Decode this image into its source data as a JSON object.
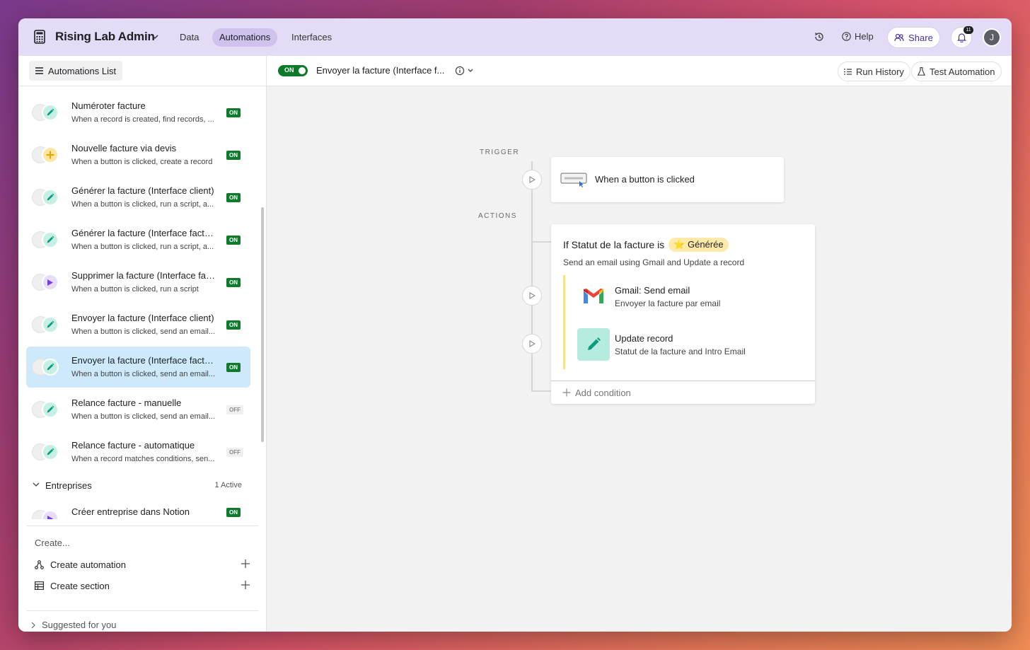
{
  "app": {
    "title": "Rising Lab Admin",
    "nav": [
      "Data",
      "Automations",
      "Interfaces"
    ],
    "active_nav": "Automations",
    "help_label": "Help",
    "share_label": "Share",
    "notification_count": "11",
    "avatar_initial": "J",
    "accent": "#e4dcf6"
  },
  "sidebar": {
    "list_button": "Automations List",
    "automations": [
      {
        "title": "Numéroter facture",
        "subtitle": "When a record is created, find records, ...",
        "status": "ON",
        "trigger_icon": "record-icon",
        "action_icon": "pencil-icon",
        "action_color": "#c7f0e4"
      },
      {
        "title": "Nouvelle facture via devis",
        "subtitle": "When a button is clicked, create a record",
        "status": "ON",
        "trigger_icon": "button-icon",
        "action_icon": "plus-icon",
        "action_color": "#fde6a4"
      },
      {
        "title": "Générer la facture (Interface client)",
        "subtitle": "When a button is clicked, run a script, a...",
        "status": "ON",
        "trigger_icon": "button-icon",
        "action_icon": "pencil-icon",
        "action_color": "#c7f0e4"
      },
      {
        "title": "Générer la facture (Interface facture)",
        "subtitle": "When a button is clicked, run a script, a...",
        "status": "ON",
        "trigger_icon": "button-icon",
        "action_icon": "pencil-icon",
        "action_color": "#c7f0e4"
      },
      {
        "title": "Supprimer la facture (Interface facture)",
        "subtitle": "When a button is clicked, run a script",
        "status": "ON",
        "trigger_icon": "button-icon",
        "action_icon": "play-icon",
        "action_color": "#e6ddfb"
      },
      {
        "title": "Envoyer la facture (Interface client)",
        "subtitle": "When a button is clicked, send an email...",
        "status": "ON",
        "trigger_icon": "button-icon",
        "action_icon": "pencil-icon",
        "action_color": "#c7f0e4"
      },
      {
        "title": "Envoyer la facture (Interface facture)",
        "subtitle": "When a button is clicked, send an email...",
        "status": "ON",
        "trigger_icon": "button-icon",
        "action_icon": "pencil-icon",
        "action_color": "#c7f0e4",
        "selected": true
      },
      {
        "title": "Relance facture - manuelle",
        "subtitle": "When a button is clicked, send an email...",
        "status": "OFF",
        "trigger_icon": "button-icon",
        "action_icon": "pencil-icon",
        "action_color": "#c7f0e4"
      },
      {
        "title": "Relance facture - automatique",
        "subtitle": "When a record matches conditions, sen...",
        "status": "OFF",
        "trigger_icon": "conditions-icon",
        "action_icon": "pencil-icon",
        "action_color": "#c7f0e4"
      },
      {
        "title": "Créer entreprise dans Notion",
        "subtitle": "",
        "status": "ON",
        "trigger_icon": "record-icon",
        "action_icon": "play-icon",
        "action_color": "#e6ddfb"
      }
    ],
    "section": {
      "label": "Entreprises",
      "count": "1 Active"
    },
    "create_label": "Create...",
    "create_automation": "Create automation",
    "create_section": "Create section",
    "suggested": "Suggested for you"
  },
  "main": {
    "toggle_label": "ON",
    "automation_name": "Envoyer la facture (Interface f...",
    "run_history": "Run History",
    "test_automation": "Test Automation",
    "trigger_label": "TRIGGER",
    "actions_label": "ACTIONS",
    "trigger_text": "When a button is clicked",
    "condition_prefix": "If Statut de la facture is",
    "condition_value": "⭐ Générée",
    "condition_desc": "Send an email using Gmail and Update a record",
    "steps": [
      {
        "title": "Gmail: Send email",
        "subtitle": "Envoyer la facture par email",
        "icon": "gmail-icon"
      },
      {
        "title": "Update record",
        "subtitle": "Statut de la facture and Intro Email",
        "icon": "pencil-icon"
      }
    ],
    "add_condition": "Add condition"
  }
}
